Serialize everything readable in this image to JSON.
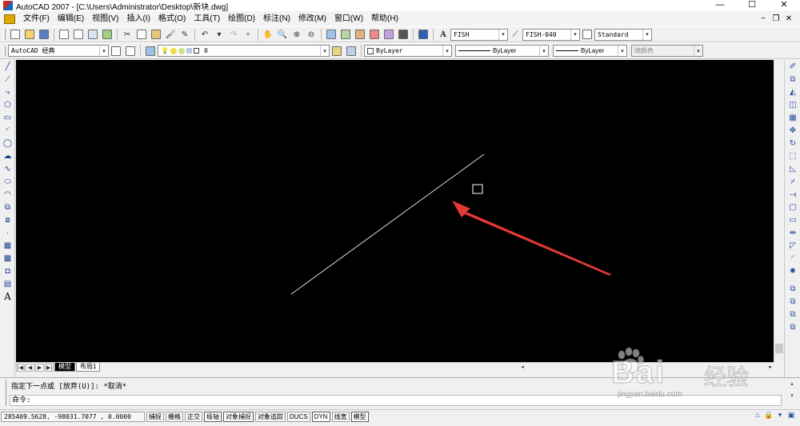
{
  "window": {
    "title": "AutoCAD 2007 - [C:\\Users\\Administrator\\Desktop\\新块.dwg]",
    "controls": {
      "minimize": "—",
      "maximize": "☐",
      "close": "✕"
    }
  },
  "menubar": {
    "items": [
      {
        "label": "文件(F)"
      },
      {
        "label": "编辑(E)"
      },
      {
        "label": "视图(V)"
      },
      {
        "label": "插入(I)"
      },
      {
        "label": "格式(O)"
      },
      {
        "label": "工具(T)"
      },
      {
        "label": "绘图(D)"
      },
      {
        "label": "标注(N)"
      },
      {
        "label": "修改(M)"
      },
      {
        "label": "窗口(W)"
      },
      {
        "label": "帮助(H)"
      }
    ],
    "mdi_controls": {
      "minimize": "−",
      "restore": "❐",
      "close": "✕"
    }
  },
  "toolbar1": {
    "text_style": "FISH",
    "dim_style": "FISH-040",
    "table_style": "Standard"
  },
  "toolbar2": {
    "workspace": "AutoCAD 经典",
    "layer": "0",
    "color": "ByLayer",
    "linetype": "ByLayer",
    "lineweight": "ByLayer",
    "plot_style": "随颜色"
  },
  "layout_tabs": {
    "tabs": [
      {
        "label": "模型",
        "active": true
      },
      {
        "label": "布局1",
        "active": false
      }
    ],
    "nav_buttons": [
      "|◀",
      "◀",
      "▶",
      "▶|"
    ]
  },
  "command": {
    "history": "指定下一点或 [放弃(U)]: *取消*",
    "prompt": "命令:"
  },
  "statusbar": {
    "coordinates": "285409.5628, -98031.7077 , 0.0000",
    "toggles": [
      {
        "label": "捕捉",
        "on": false
      },
      {
        "label": "栅格",
        "on": false
      },
      {
        "label": "正交",
        "on": false
      },
      {
        "label": "极轴",
        "on": true
      },
      {
        "label": "对象捕捉",
        "on": true
      },
      {
        "label": "对象追踪",
        "on": false
      },
      {
        "label": "DUCS",
        "on": false
      },
      {
        "label": "DYN",
        "on": true
      },
      {
        "label": "线宽",
        "on": false
      },
      {
        "label": "模型",
        "on": true
      }
    ]
  },
  "watermark": {
    "brand": "Bai",
    "brand_cn": "经验",
    "url": "jingyan.baidu.com"
  },
  "colors": {
    "canvas": "#000000",
    "drawn_line": "#d9d9d9",
    "arrow": "#e53935",
    "cursor_box": "#ffffff"
  }
}
